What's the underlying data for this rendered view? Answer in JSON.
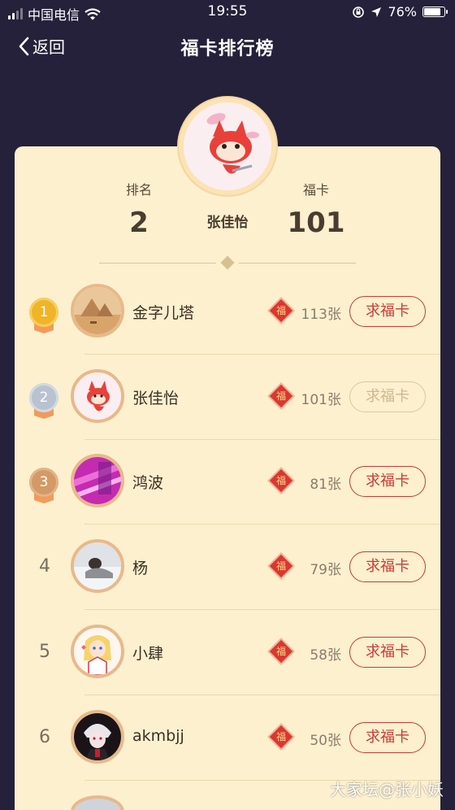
{
  "status_bar": {
    "carrier": "中国电信",
    "time": "19:55",
    "battery": "76%",
    "battery_level": 0.76
  },
  "nav": {
    "back_label": "返回",
    "title": "福卡排行榜"
  },
  "me": {
    "rank_label": "排名",
    "rank": "2",
    "name": "张佳怡",
    "cards_label": "福卡",
    "cards": "101"
  },
  "leaderboard": [
    {
      "rank": "1",
      "name": "金字儿塔",
      "count": "113张",
      "button": "求福卡",
      "medal": "gold"
    },
    {
      "rank": "2",
      "name": "张佳怡",
      "count": "101张",
      "button": "求福卡",
      "medal": "silver",
      "disabled": true
    },
    {
      "rank": "3",
      "name": "鸿波",
      "count": "81张",
      "button": "求福卡",
      "medal": "bronze"
    },
    {
      "rank": "4",
      "name": "杨",
      "count": "79张",
      "button": "求福卡"
    },
    {
      "rank": "5",
      "name": "小肆",
      "count": "58张",
      "button": "求福卡"
    },
    {
      "rank": "6",
      "name": "akmbjj",
      "count": "50张",
      "button": "求福卡"
    }
  ],
  "fu_icon_char": "福",
  "watermark": "大家坛@张小妖",
  "colors": {
    "background": "#25213a",
    "card": "#fdf0cf",
    "accent": "#c83b35",
    "gold": "#f0b429",
    "silver": "#b9c2cf",
    "bronze": "#d49a66"
  }
}
